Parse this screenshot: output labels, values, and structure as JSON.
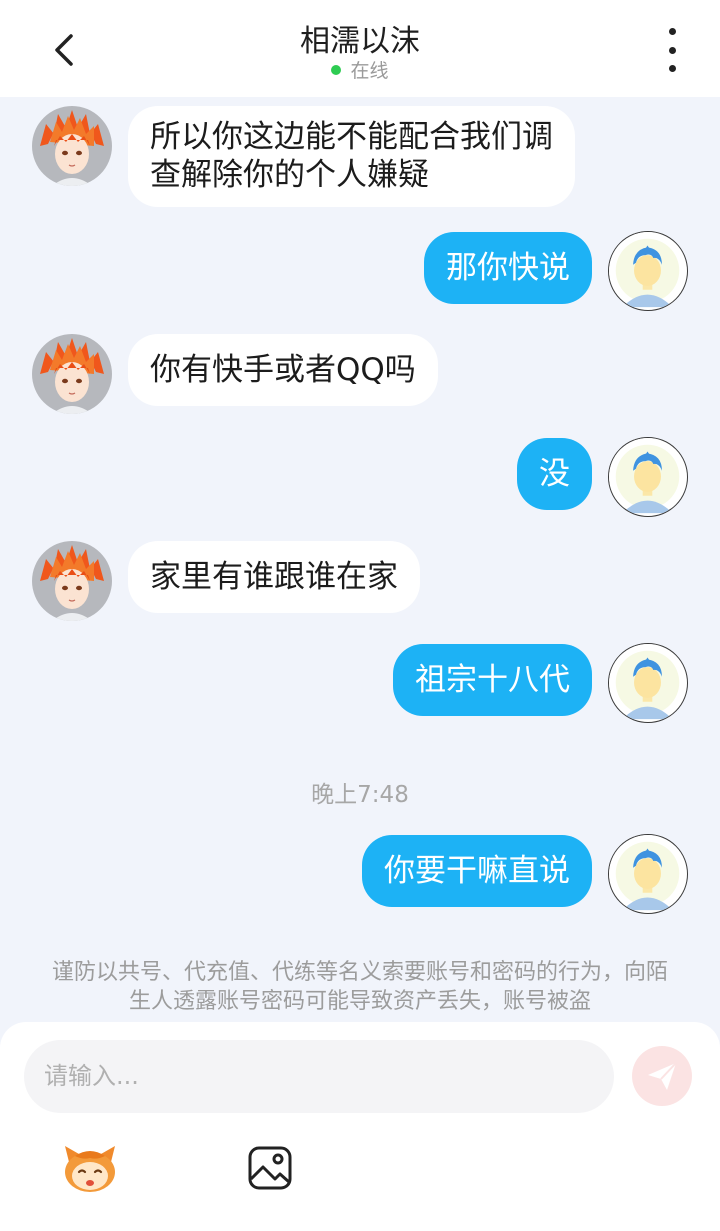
{
  "header": {
    "title": "相濡以沫",
    "status": "在线",
    "back_icon": "back-arrow-icon",
    "more_icon": "more-vertical-icon"
  },
  "messages": [
    {
      "side": "left",
      "line1": "所以你这边能不能配合我们调",
      "line2": "查解除你的个人嫌疑"
    },
    {
      "side": "right",
      "text": "那你快说"
    },
    {
      "side": "left",
      "text": "你有快手或者QQ吗"
    },
    {
      "side": "right",
      "text": "没"
    },
    {
      "side": "left",
      "text": "家里有谁跟谁在家"
    },
    {
      "side": "right",
      "text": "祖宗十八代"
    },
    {
      "side": "right",
      "text": "你要干嘛直说"
    }
  ],
  "timestamp": "晚上7:48",
  "notice": "谨防以共号、代充值、代练等名义索要账号和密码的行为，向陌生人透露账号密码可能导致资产丢失，账号被盗",
  "input": {
    "placeholder": "请输入...",
    "send_icon": "send-icon",
    "emoji_icon": "emoji-mascot-icon",
    "image_icon": "image-icon"
  },
  "colors": {
    "bubble_right": "#1db2f5",
    "bubble_left": "#ffffff",
    "background": "#f1f4fb",
    "online_dot": "#2ecc52"
  }
}
